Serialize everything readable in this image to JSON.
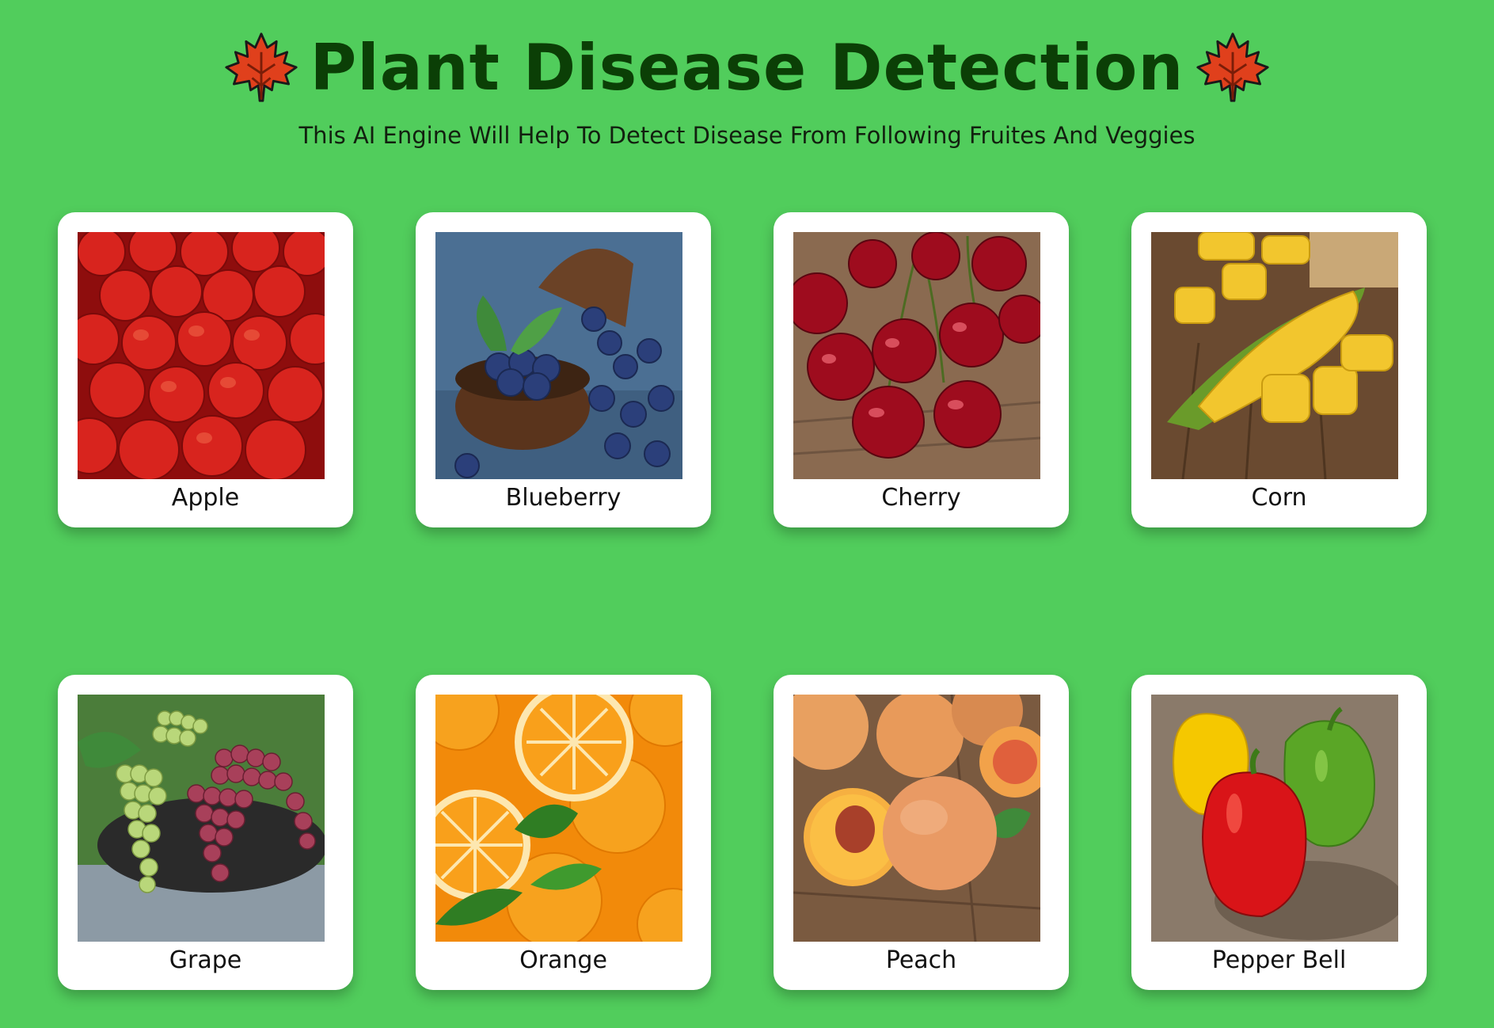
{
  "header": {
    "title": "Plant Disease Detection",
    "subtitle": "This AI Engine Will Help To Detect Disease From Following Fruites And Veggies",
    "leaf_icon": "maple-leaf-icon"
  },
  "crops": [
    {
      "label": "Apple"
    },
    {
      "label": "Blueberry"
    },
    {
      "label": "Cherry"
    },
    {
      "label": "Corn"
    },
    {
      "label": "Grape"
    },
    {
      "label": "Orange"
    },
    {
      "label": "Peach"
    },
    {
      "label": "Pepper Bell"
    }
  ],
  "colors": {
    "background": "#51cd5c",
    "title": "#0b3f06",
    "card": "#ffffff",
    "leaf": "#e0401c"
  }
}
